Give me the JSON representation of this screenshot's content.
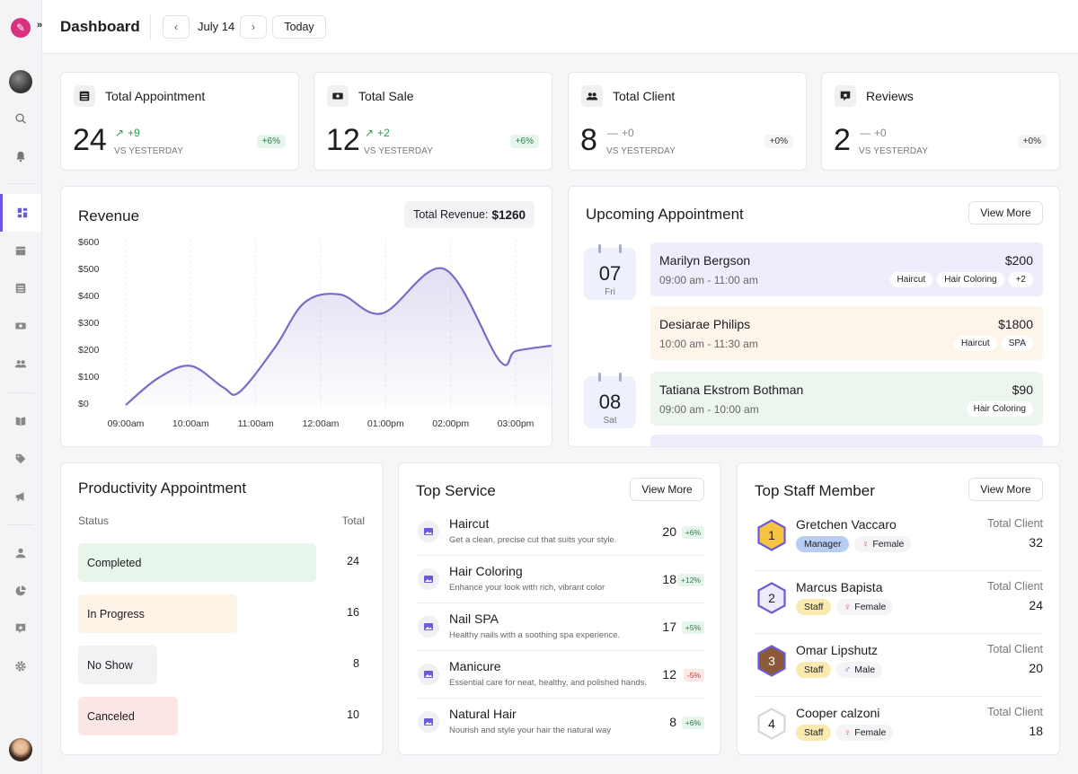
{
  "header": {
    "title": "Dashboard",
    "date": "July 14",
    "today_label": "Today",
    "prev_icon": "chevron-left-icon",
    "next_icon": "chevron-right-icon"
  },
  "stats": [
    {
      "title": "Total Appointment",
      "value": "24",
      "delta": "+9",
      "delta_dir": "up",
      "vs": "VS YESTERDAY",
      "badge": "+6%",
      "icon": "list-icon"
    },
    {
      "title": "Total Sale",
      "value": "12",
      "delta": "+2",
      "delta_dir": "up",
      "vs": "VS YESTERDAY",
      "badge": "+6%",
      "icon": "money-icon"
    },
    {
      "title": "Total Client",
      "value": "8",
      "delta": "+0",
      "delta_dir": "flat",
      "vs": "VS YESTERDAY",
      "badge": "+0%",
      "icon": "users-icon"
    },
    {
      "title": "Reviews",
      "value": "2",
      "delta": "+0",
      "delta_dir": "flat",
      "vs": "VS YESTERDAY",
      "badge": "+0%",
      "icon": "review-icon"
    }
  ],
  "revenue": {
    "title": "Revenue",
    "total_label": "Total Revenue:",
    "total_value": "$1260"
  },
  "chart_data": {
    "type": "area",
    "title": "Revenue",
    "categories": [
      "09:00am",
      "10:00am",
      "11:00am",
      "12:00am",
      "01:00pm",
      "02:00pm",
      "03:00pm"
    ],
    "y_ticks": [
      "$600",
      "$500",
      "$400",
      "$300",
      "$200",
      "$100",
      "$0"
    ],
    "ylim": [
      0,
      600
    ],
    "series": [
      {
        "values": [
          [
            0,
            0
          ],
          [
            0.5,
            100
          ],
          [
            1.0,
            145
          ],
          [
            1.5,
            65
          ],
          [
            1.75,
            48
          ],
          [
            2.3,
            215
          ],
          [
            2.75,
            380
          ],
          [
            3.3,
            410
          ],
          [
            3.95,
            340
          ],
          [
            4.9,
            505
          ],
          [
            5.75,
            165
          ],
          [
            6.0,
            200
          ],
          [
            6.55,
            220
          ]
        ]
      }
    ],
    "accent": "#7a6cc6"
  },
  "upcoming": {
    "title": "Upcoming Appointment",
    "view_more": "View More",
    "days": [
      {
        "num": "07",
        "day": "Fri"
      },
      {
        "num": "08",
        "day": "Sat"
      }
    ],
    "items": [
      {
        "name": "Marilyn Bergson",
        "time": "09:00 am - 11:00 am",
        "price": "$200",
        "tags": [
          "Haircut",
          "Hair Coloring",
          "+2"
        ],
        "color": "#efedfb"
      },
      {
        "name": "Desiarae Philips",
        "time": "10:00 am - 11:30 am",
        "price": "$1800",
        "tags": [
          "Haircut",
          "SPA"
        ],
        "color": "#fdf4ea"
      },
      {
        "name": "Tatiana Ekstrom Bothman",
        "time": "09:00 am - 10:00 am",
        "price": "$90",
        "tags": [
          "Hair Coloring"
        ],
        "color": "#edf6ee"
      }
    ]
  },
  "productivity": {
    "title": "Productivity Appointment",
    "status_header": "Status",
    "total_header": "Total",
    "rows": [
      {
        "label": "Completed",
        "value": "24",
        "color": "#e8f5ea",
        "share": 1.0
      },
      {
        "label": "In Progress",
        "value": "16",
        "color": "#fdf3e7",
        "share": 0.667
      },
      {
        "label": "No Show",
        "value": "8",
        "color": "#f2f2f4",
        "share": 0.333
      },
      {
        "label": "Canceled",
        "value": "10",
        "color": "#fde7e6",
        "share": 0.417
      }
    ]
  },
  "top_service": {
    "title": "Top Service",
    "view_more": "View More",
    "items": [
      {
        "name": "Haircut",
        "desc": "Get a clean, precise cut that suits your style.",
        "count": "20",
        "badge": "+6%",
        "trend": "up"
      },
      {
        "name": "Hair Coloring",
        "desc": "Enhance your look with rich, vibrant color",
        "count": "18",
        "badge": "+12%",
        "trend": "up"
      },
      {
        "name": "Nail SPA",
        "desc": "Healthy nails with a soothing spa experience.",
        "count": "17",
        "badge": "+5%",
        "trend": "up"
      },
      {
        "name": "Manicure",
        "desc": "Essential care for neat, healthy, and polished hands.",
        "count": "12",
        "badge": "-5%",
        "trend": "down"
      },
      {
        "name": "Natural Hair",
        "desc": "Nourish and style your hair the natural way",
        "count": "8",
        "badge": "+6%",
        "trend": "up"
      }
    ]
  },
  "top_staff": {
    "title": "Top Staff Member",
    "view_more": "View More",
    "total_label": "Total Client",
    "items": [
      {
        "rank": "1",
        "name": "Gretchen Vaccaro",
        "role": "Manager",
        "gender": "Female",
        "total": "32",
        "hex_fill": "#f5c443",
        "hex_stroke": "#6b5bd6",
        "rank_color": "#1c1c21",
        "role_bg": "#b7cdf5"
      },
      {
        "rank": "2",
        "name": "Marcus Bapista",
        "role": "Staff",
        "gender": "Female",
        "total": "24",
        "hex_fill": "#eceafb",
        "hex_stroke": "#6b5bd6",
        "rank_color": "#1c1c21",
        "role_bg": "#faeab0"
      },
      {
        "rank": "3",
        "name": "Omar Lipshutz",
        "role": "Staff",
        "gender": "Male",
        "total": "20",
        "hex_fill": "#8b5a3a",
        "hex_stroke": "#6b5bd6",
        "rank_color": "#ffffff",
        "role_bg": "#faeab0"
      },
      {
        "rank": "4",
        "name": "Cooper calzoni",
        "role": "Staff",
        "gender": "Female",
        "total": "18",
        "hex_fill": "#ffffff",
        "hex_stroke": "#d6d6dc",
        "rank_color": "#1c1c21",
        "role_bg": "#faeab0"
      }
    ]
  },
  "sidebar": {
    "icons": [
      "search-icon",
      "bell-icon",
      "dashboard-icon",
      "calendar-icon",
      "list-icon",
      "money-icon",
      "users-icon",
      "book-icon",
      "tag-icon",
      "megaphone-icon",
      "user-icon",
      "chart-icon",
      "review-icon",
      "gear-icon"
    ]
  }
}
